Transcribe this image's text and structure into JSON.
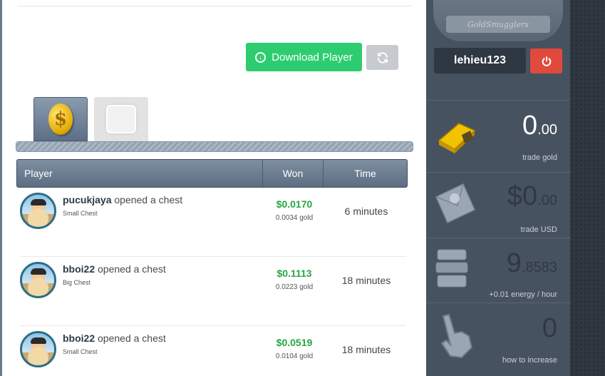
{
  "toolbar": {
    "download_label": "Download Player",
    "download_icon": "download-icon",
    "refresh_icon": "refresh-icon"
  },
  "tabs": [
    {
      "name": "gold-tab",
      "icon": "gold-coin-icon",
      "active": true
    },
    {
      "name": "chest-tab",
      "icon": "chest-icon",
      "active": false
    }
  ],
  "table": {
    "headers": {
      "player": "Player",
      "won": "Won",
      "time": "Time"
    },
    "rows": [
      {
        "user": "pucukjaya",
        "action": "opened a chest",
        "chest": "Small Chest",
        "won_usd": "$0.0170",
        "won_gold": "0.0034 gold",
        "time": "6 minutes"
      },
      {
        "user": "bboi22",
        "action": "opened a chest",
        "chest": "Big Chest",
        "won_usd": "$0.1113",
        "won_gold": "0.0223 gold",
        "time": "18 minutes"
      },
      {
        "user": "bboi22",
        "action": "opened a chest",
        "chest": "Small Chest",
        "won_usd": "$0.0519",
        "won_gold": "0.0104 gold",
        "time": "18 minutes"
      }
    ]
  },
  "sidebar": {
    "logo_text": "GoldSmugglers",
    "username": "lehieu123",
    "power_icon": "power-icon",
    "stats": [
      {
        "icon": "gold-bar-icon",
        "int": "0",
        "frac": ".00",
        "label": "trade gold"
      },
      {
        "icon": "envelope-icon",
        "int": "$0",
        "frac": ".00",
        "label": "trade USD"
      },
      {
        "icon": "energy-stack-icon",
        "int": "9",
        "frac": ".8583",
        "label": "+0.01 energy / hour"
      },
      {
        "icon": "hand-pointer-icon",
        "int": "0",
        "frac": "",
        "label": "how to increase"
      }
    ]
  },
  "colors": {
    "accent_green": "#2ecc71",
    "won_green": "#27a640",
    "power_red": "#e04a3c",
    "sidebar_bg": "#475260"
  }
}
